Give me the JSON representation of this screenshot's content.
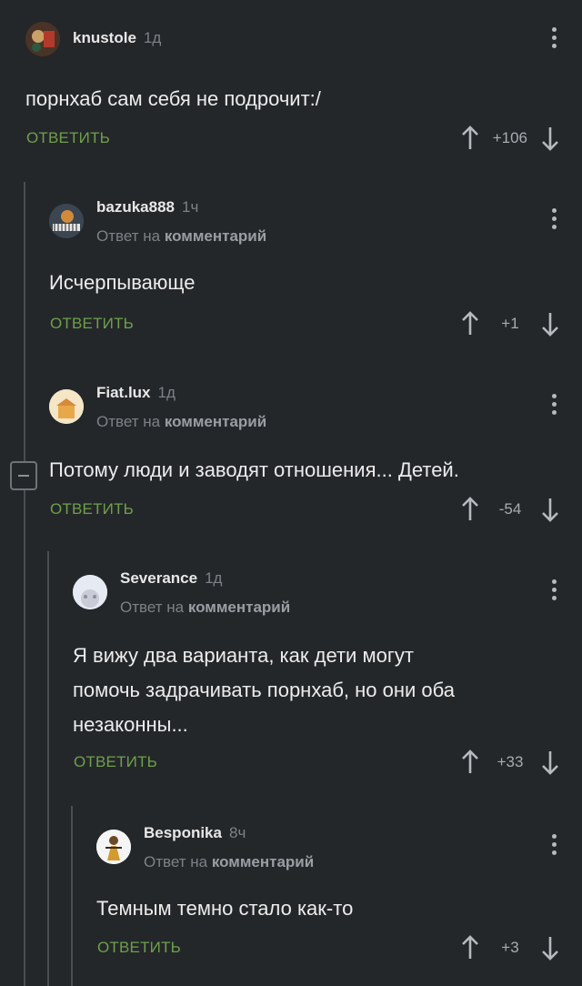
{
  "comments": [
    {
      "nick": "knustole",
      "time": "1д",
      "text": "порнхаб сам себя не подрочит:/",
      "reply_label": "ОТВЕТИТЬ",
      "score": "+106",
      "avatar_icon": "avatar-image"
    },
    {
      "nick": "bazuka888",
      "time": "1ч",
      "reply_to_prefix": "Ответ на",
      "reply_to_target": "комментарий",
      "text": "Исчерпывающе",
      "reply_label": "ОТВЕТИТЬ",
      "score": "+1",
      "avatar_icon": "avatar-image"
    },
    {
      "nick": "Fiat.lux",
      "time": "1д",
      "reply_to_prefix": "Ответ на",
      "reply_to_target": "комментарий",
      "text": "Потому люди и заводят отношения... Детей.",
      "reply_label": "ОТВЕТИТЬ",
      "score": "-54",
      "avatar_icon": "avatar-image"
    },
    {
      "nick": "Severance",
      "time": "1д",
      "reply_to_prefix": "Ответ на",
      "reply_to_target": "комментарий",
      "text_lines": [
        "Я вижу два варианта, как дети могут",
        "помочь задрачивать порнхаб, но они оба",
        "незаконны..."
      ],
      "reply_label": "ОТВЕТИТЬ",
      "score": "+33",
      "avatar_icon": "avatar-image"
    },
    {
      "nick": "Besponika",
      "time": "8ч",
      "reply_to_prefix": "Ответ на",
      "reply_to_target": "комментарий",
      "text": "Темным темно стало как-то",
      "reply_label": "ОТВЕТИТЬ",
      "score": "+3",
      "avatar_icon": "avatar-image"
    }
  ],
  "colors": {
    "background": "#24272a",
    "reply_button": "#6ea04a",
    "thread_line": "#4a4e52",
    "muted_text": "#7d8186"
  }
}
